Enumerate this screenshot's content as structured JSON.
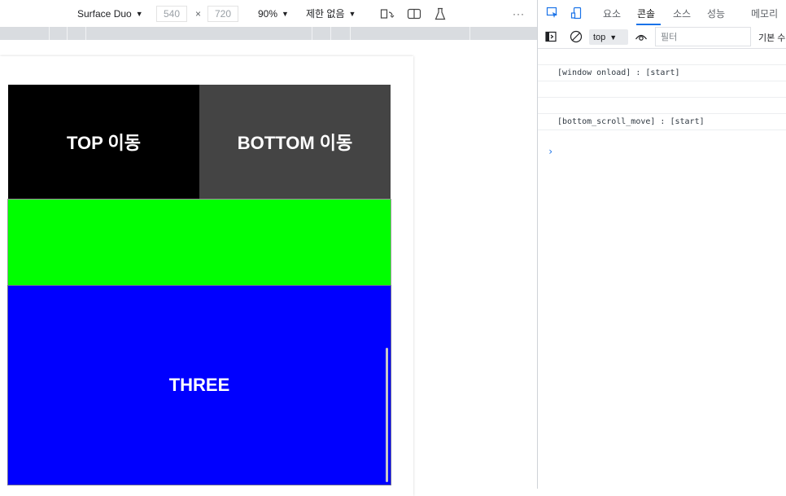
{
  "device_toolbar": {
    "device_name": "Surface Duo",
    "width_value": "540",
    "times_sign": "×",
    "height_value": "720",
    "zoom": "90%",
    "throttle": "제한 없음",
    "more_glyph": "···"
  },
  "page": {
    "top_button_label": "TOP 이동",
    "bottom_button_label": "BOTTOM 이동",
    "section_three_label": "THREE",
    "colors": {
      "top_button": "#000000",
      "bottom_button": "#444444",
      "section_two": "#00ff00",
      "section_three": "#0000ff"
    }
  },
  "devtools": {
    "tabs": [
      "요소",
      "콘솔",
      "소스",
      "성능",
      "메모리"
    ],
    "active_tab": "콘솔",
    "console_bar": {
      "context": "top",
      "filter_placeholder": "필터",
      "levels_label": "기본 수"
    },
    "log_rows": [
      "",
      "[window onload] : [start]",
      "",
      "[bottom_scroll_move] : [start]",
      ""
    ],
    "prompt": "›",
    "accent_color": "#1a73e8"
  }
}
